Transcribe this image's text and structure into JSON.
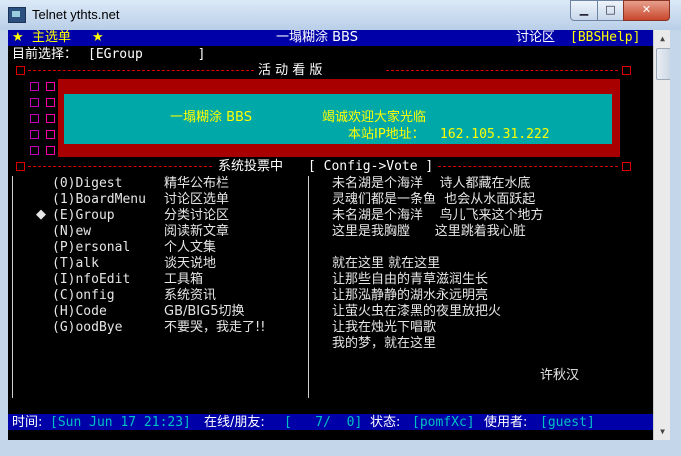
{
  "window": {
    "title": "Telnet ythts.net"
  },
  "header": {
    "star_left": "★",
    "main_menu": "主选单",
    "star_right": "★",
    "board_name": "一塌糊涂 BBS",
    "area": "讨论区",
    "area_tag": "[BBSHelp]"
  },
  "current": {
    "label": "目前选择：",
    "value": "[EGroup       ]"
  },
  "banner": {
    "title": "活 动 看 版",
    "site": "一塌糊涂 BBS",
    "welcome": "竭诚欢迎大家光临",
    "ip_label": "本站IP地址：",
    "ip": "162.105.31.222"
  },
  "vote": {
    "label": "系统投票中",
    "tag": "[ Config->Vote ]"
  },
  "menu": [
    {
      "key": "(0)Digest",
      "desc": "精华公布栏"
    },
    {
      "key": "(1)BoardMenu",
      "desc": "讨论区选单"
    },
    {
      "key": "(E)Group",
      "desc": "分类讨论区"
    },
    {
      "key": "(N)ew",
      "desc": "阅读新文章"
    },
    {
      "key": "(P)ersonal",
      "desc": "个人文集"
    },
    {
      "key": "(T)alk",
      "desc": "谈天说地"
    },
    {
      "key": "(I)nfoEdit",
      "desc": "工具箱"
    },
    {
      "key": "(C)onfig",
      "desc": "系统资讯"
    },
    {
      "key": "(H)Code",
      "desc": "GB/BIG5切换"
    },
    {
      "key": "(G)oodBye",
      "desc": "不要哭，我走了!!"
    }
  ],
  "cursor": "◆",
  "poem": {
    "lines": [
      "未名湖是个海洋    诗人都藏在水底",
      "灵魂们都是一条鱼  也会从水面跃起",
      "未名湖是个海洋    鸟儿飞来这个地方",
      "这里是我胸膛      这里跳着我心脏",
      "",
      "就在这里 就在这里",
      "让那些自由的青草滋润生长",
      "让那泓静静的湖水永远明亮",
      "让萤火虫在漆黑的夜里放把火",
      "让我在烛光下唱歌",
      "我的梦，就在这里"
    ],
    "author": "许秋汉"
  },
  "status": {
    "time_label": "时间:",
    "time": "[Sun Jun 17 21:23]",
    "online_label": "在线/朋友:",
    "online": "[   7/  0]",
    "state_label": "状态:",
    "state": "[pomfXc]",
    "user_label": "使用者:",
    "user": "[guest]"
  },
  "colors": {
    "header_bg": "#0000a8",
    "banner_red": "#a80000",
    "banner_cyan": "#00a8a8",
    "text_yellow": "#ffff00"
  }
}
